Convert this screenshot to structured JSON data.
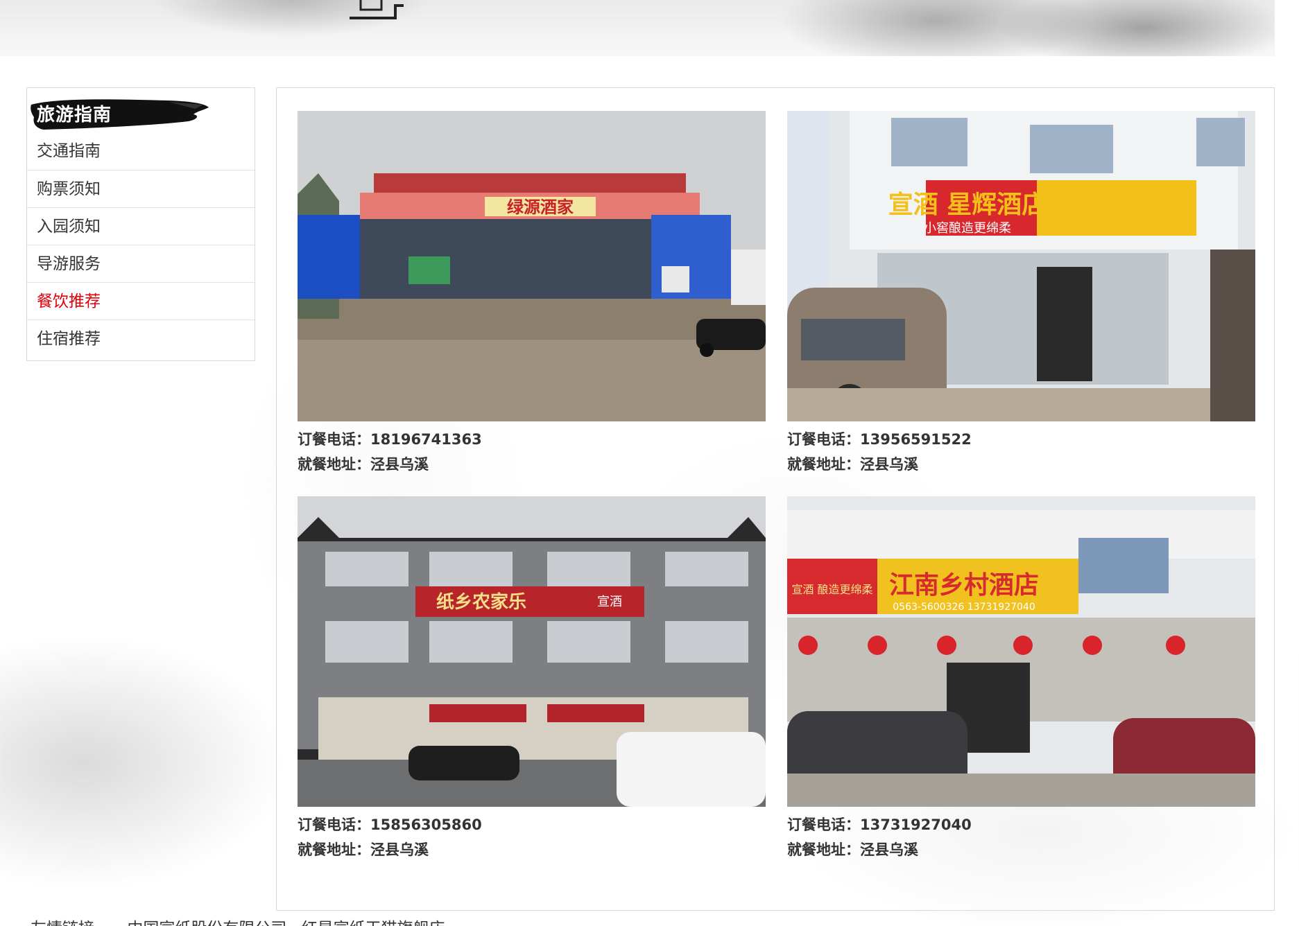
{
  "sidebar": {
    "title": "旅游指南",
    "items": [
      {
        "label": "交通指南",
        "active": false
      },
      {
        "label": "购票须知",
        "active": false
      },
      {
        "label": "入园须知",
        "active": false
      },
      {
        "label": "导游服务",
        "active": false
      },
      {
        "label": "餐饮推荐",
        "active": true
      },
      {
        "label": "住宿推荐",
        "active": false
      }
    ]
  },
  "restaurants": [
    {
      "sign": "绿源酒家",
      "phone_label": "订餐电话：",
      "phone": "18196741363",
      "address_label": "就餐地址：",
      "address": "泾县乌溪"
    },
    {
      "sign": "宣酒 星辉酒店",
      "sign_sub": "小窖酿造更绵柔",
      "phone_label": "订餐电话：",
      "phone": "13956591522",
      "address_label": "就餐地址：",
      "address": "泾县乌溪"
    },
    {
      "sign": "纸乡农家乐",
      "sign_sub": "宣酒",
      "phone_label": "订餐电话：",
      "phone": "15856305860",
      "address_label": "就餐地址：",
      "address": "泾县乌溪"
    },
    {
      "sign": "江南乡村酒店",
      "sign_sub": "宣酒 酿造更绵柔",
      "sign_phone": "0563-5600326 13731927040",
      "phone_label": "订餐电话：",
      "phone": "13731927040",
      "address_label": "就餐地址：",
      "address": "泾县乌溪"
    }
  ],
  "footer": {
    "label": "友情链接",
    "links": [
      "中国宣纸股份有限公司",
      "红星宣纸天猫旗舰店"
    ]
  },
  "colors": {
    "active_menu": "#e0000a",
    "text": "#333333",
    "border": "#d8d8d8"
  }
}
